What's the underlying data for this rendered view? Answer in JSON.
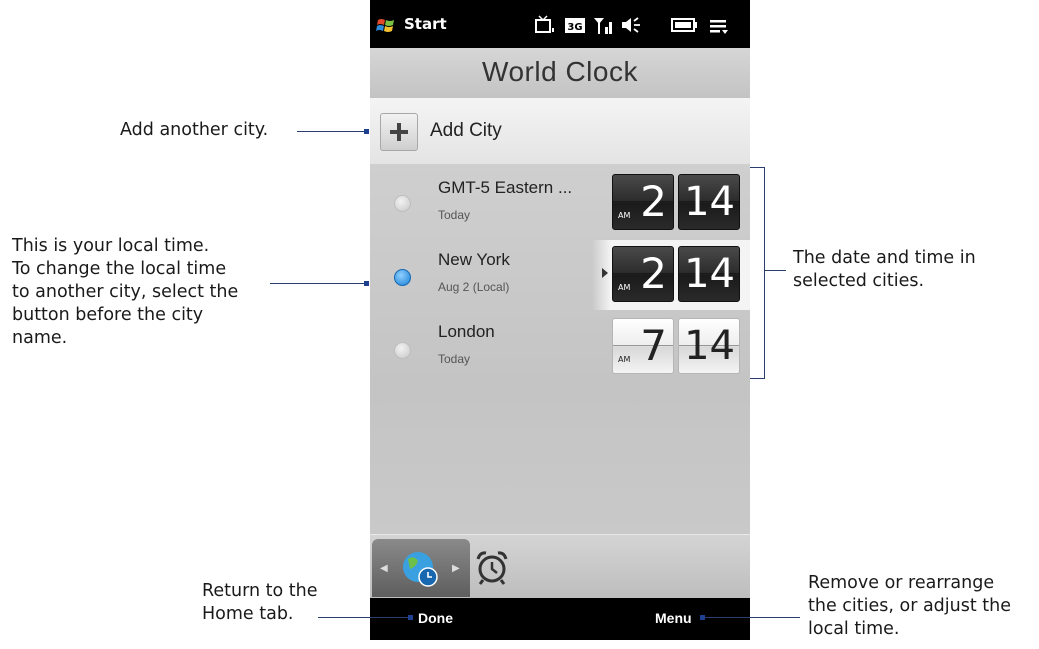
{
  "status_bar": {
    "start_label": "Start",
    "icons": [
      "windows-logo-icon",
      "tv-icon",
      "3g-icon",
      "signal-icon",
      "volume-icon",
      "battery-icon",
      "menu-icon"
    ]
  },
  "app": {
    "title": "World Clock"
  },
  "add_city": {
    "label": "Add City"
  },
  "cities": [
    {
      "name": "GMT-5 Eastern ...",
      "sub": "Today",
      "hour": "2",
      "minute": "14",
      "ampm": "AM",
      "style": "dark",
      "selected": false
    },
    {
      "name": "New York",
      "sub": "Aug 2  (Local)",
      "hour": "2",
      "minute": "14",
      "ampm": "AM",
      "style": "dark",
      "selected": true
    },
    {
      "name": "London",
      "sub": "Today",
      "hour": "7",
      "minute": "14",
      "ampm": "AM",
      "style": "light",
      "selected": false
    }
  ],
  "tabs": {
    "icons": [
      "world-clock-tab-icon",
      "alarm-tab-icon"
    ]
  },
  "softkeys": {
    "left": "Done",
    "right": "Menu"
  },
  "callouts": {
    "add_city": "Add another city.",
    "local_time": [
      "This is your local time.",
      "To change the local time",
      "to another city, select the",
      "button before the city",
      "name."
    ],
    "date_time": [
      "The date and time in",
      "selected cities."
    ],
    "home_tab": [
      "Return to the",
      "Home tab."
    ],
    "menu": [
      "Remove or rearrange",
      "the cities, or adjust the",
      "local time."
    ]
  },
  "colors": {
    "accent_radio": "#1a7fd6",
    "callout_line": "#2a3d6e"
  }
}
